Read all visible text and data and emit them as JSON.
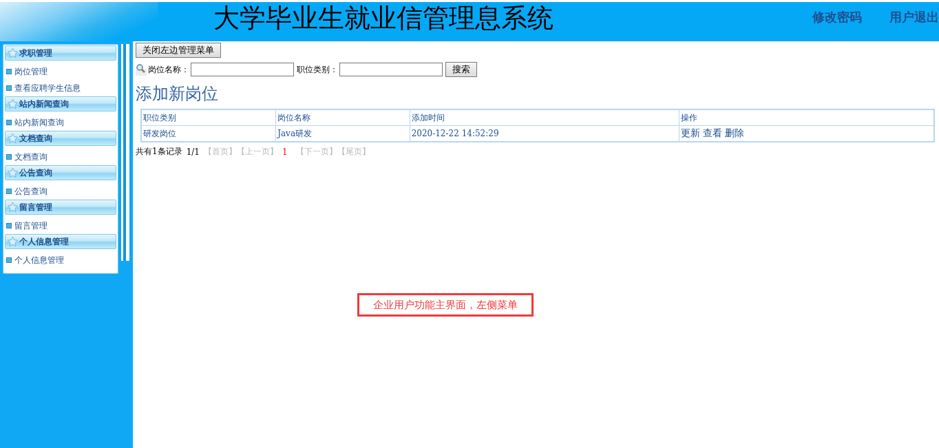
{
  "header": {
    "title": "大学毕业生就业信管理息系统",
    "links": [
      "修改密码",
      "用户退出"
    ]
  },
  "sidebar": {
    "groups": [
      {
        "title": "求职管理",
        "items": [
          "岗位管理",
          "查看应聘学生信息"
        ]
      },
      {
        "title": "站内新闻查询",
        "items": [
          "站内新闻查询"
        ]
      },
      {
        "title": "文档查询",
        "items": [
          "文档查询"
        ]
      },
      {
        "title": "公告查询",
        "items": [
          "公告查询"
        ]
      },
      {
        "title": "留言管理",
        "items": [
          "留言管理"
        ]
      },
      {
        "title": "个人信息管理",
        "items": [
          "个人信息管理"
        ]
      }
    ]
  },
  "toggle_button": "关闭左边管理菜单",
  "search": {
    "fields": [
      {
        "label": "岗位名称："
      },
      {
        "label": "职位类别："
      }
    ],
    "button": "搜索"
  },
  "heading": "添加新岗位",
  "table": {
    "columns": [
      "职位类别",
      "岗位名称",
      "添加时间",
      "操作"
    ],
    "rows": [
      {
        "cells": [
          "研发岗位",
          "Java研发",
          "2020-12-22 14:52:29"
        ],
        "actions": [
          "更新",
          "查看",
          "删除"
        ]
      }
    ]
  },
  "pager": {
    "summary": "共有1条记录",
    "page": "1/1",
    "items": [
      {
        "kind": "nav",
        "label": "【首页】",
        "disabled": true
      },
      {
        "kind": "nav",
        "label": "【上一页】",
        "disabled": true
      },
      {
        "kind": "current",
        "label": "1"
      },
      {
        "kind": "nav",
        "label": "【下一页】",
        "disabled": true
      },
      {
        "kind": "nav",
        "label": "【尾页】",
        "disabled": true
      }
    ]
  },
  "annotation": "企业用户功能主界面，左侧菜单"
}
